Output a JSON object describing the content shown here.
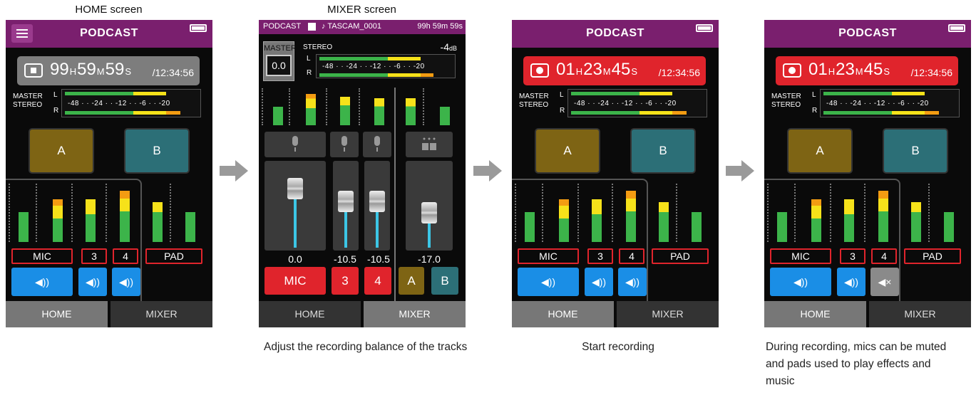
{
  "captions": {
    "home_title": "HOME screen",
    "mixer_title": "MIXER screen",
    "mixer_desc": "Adjust the recording balance of the tracks",
    "start_desc": "Start recording",
    "during_desc": "During recording, mics can be muted and pads used to play effects and music"
  },
  "screens": {
    "home": {
      "title": "PODCAST",
      "time_h": "99",
      "time_m": "59",
      "time_s": "59",
      "unit_h": "H",
      "unit_m": "M",
      "unit_s": "S",
      "total": "/12:34:56",
      "master_label_1": "MASTER",
      "master_label_2": "STEREO",
      "meter_l": "L",
      "meter_r": "R",
      "meter_scale": "-48 · · -24 · · -12 · · -6 · · -20",
      "pad_a": "A",
      "pad_b": "B",
      "tracks": [
        "MIC",
        "3",
        "4",
        "PAD"
      ],
      "tab_home": "HOME",
      "tab_mixer": "MIXER"
    },
    "mixer": {
      "title": "PODCAST",
      "file": "♪ TASCAM_0001",
      "remaining": "99h 59m 59s",
      "master_label": "MASTER",
      "master_value": "0.0",
      "stereo_label": "STEREO",
      "peak": "-4",
      "peak_unit": "dB",
      "meter_l": "L",
      "meter_r": "R",
      "meter_scale": "-48 · · -24 · · -12 · · -6 · · -20",
      "values": [
        "0.0",
        "-10.5",
        "-10.5",
        "-17.0"
      ],
      "buttons": [
        "MIC",
        "3",
        "4",
        "A",
        "B"
      ],
      "tab_home": "HOME",
      "tab_mixer": "MIXER"
    },
    "rec1": {
      "title": "PODCAST",
      "time_h": "01",
      "time_m": "23",
      "time_s": "45",
      "unit_h": "H",
      "unit_m": "M",
      "unit_s": "S",
      "total": "/12:34:56",
      "master_label_1": "MASTER",
      "master_label_2": "STEREO",
      "meter_l": "L",
      "meter_r": "R",
      "meter_scale": "-48 · · -24 · · -12 · · -6 · · -20",
      "pad_a": "A",
      "pad_b": "B",
      "tracks": [
        "MIC",
        "3",
        "4",
        "PAD"
      ],
      "tab_home": "HOME",
      "tab_mixer": "MIXER"
    },
    "rec2": {
      "title": "PODCAST",
      "time_h": "01",
      "time_m": "23",
      "time_s": "45",
      "unit_h": "H",
      "unit_m": "M",
      "unit_s": "S",
      "total": "/12:34:56",
      "master_label_1": "MASTER",
      "master_label_2": "STEREO",
      "meter_l": "L",
      "meter_r": "R",
      "meter_scale": "-48 · · -24 · · -12 · · -6 · · -20",
      "pad_a": "A",
      "pad_b": "B",
      "tracks": [
        "MIC",
        "3",
        "4",
        "PAD"
      ],
      "tab_home": "HOME",
      "tab_mixer": "MIXER"
    }
  },
  "icons": {
    "speaker_on": "speaker-on-icon",
    "speaker_muted": "speaker-muted-icon",
    "arrow": "arrow-right-icon"
  },
  "colors": {
    "titlebar": "#7a1f6e",
    "record": "#e0242c",
    "speaker_on": "#1a8ee6",
    "pad_a": "#7e6414",
    "pad_b": "#2c6f77",
    "meter_green": "#3cb44a",
    "meter_yellow": "#f6e21a",
    "meter_orange": "#f39c12"
  }
}
